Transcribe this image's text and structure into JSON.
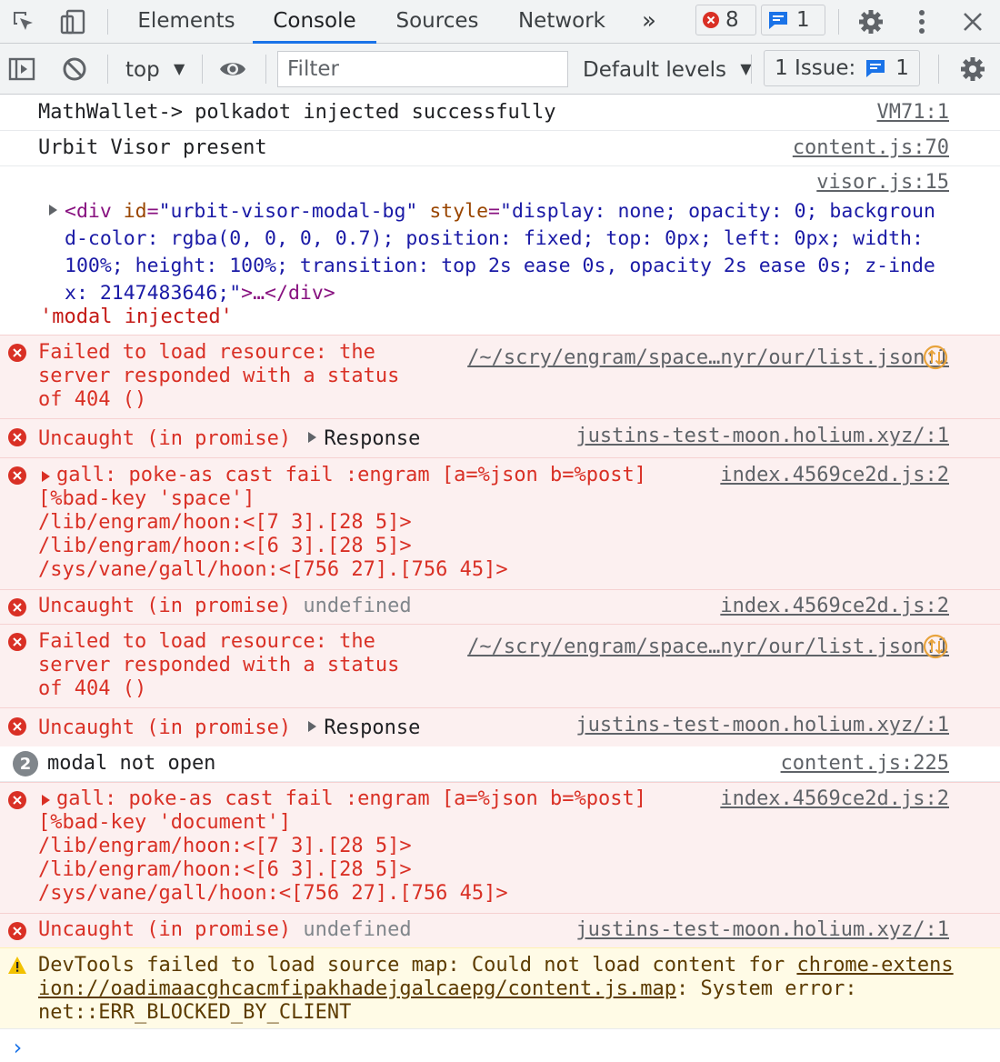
{
  "tabs": {
    "items": [
      "Elements",
      "Console",
      "Sources",
      "Network"
    ],
    "more": "»",
    "error_count": "8",
    "message_count": "1"
  },
  "toolbar": {
    "context": "top",
    "filter_placeholder": "Filter",
    "levels": "Default levels",
    "issues_label": "1 Issue:",
    "issues_count": "1"
  },
  "messages": {
    "m1": {
      "text": "MathWallet-> polkadot injected successfully",
      "source": "VM71:1"
    },
    "m2": {
      "text": "Urbit Visor present",
      "source": "content.js:70"
    },
    "m3": {
      "source": "visor.js:15",
      "tag_open": "<div",
      "attr1": "id",
      "val1": "\"urbit-visor-modal-bg\"",
      "attr2": "style",
      "val2_l1": "\"display: none; opacity: 0; backgroun",
      "val2_l2": "d-color: rgba(0, 0, 0, 0.7); position: fixed; top: 0px; left: 0px; width:",
      "val2_l3": "100%; height: 100%; transition: top 2s ease 0s, opacity 2s ease 0s; z-inde",
      "val2_l4": "x: 2147483646;\"",
      "tag_close": ">…</div>",
      "string": "'modal injected'"
    },
    "e1": {
      "text": "Failed to load resource: the\nserver responded with a status\nof 404 ()",
      "source": "/~/scry/engram/space…nyr/our/list.json:1"
    },
    "e2": {
      "text": "Uncaught (in promise)",
      "obj": "Response",
      "source": "justins-test-moon.holium.xyz/:1"
    },
    "e3": {
      "text": "gall: poke-as cast fail :engram [a=%json b=%post]\n[%bad-key 'space']\n/lib/engram/hoon:<[7 3].[28 5]>\n/lib/engram/hoon:<[6 3].[28 5]>\n/sys/vane/gall/hoon:<[756 27].[756 45]>",
      "source": "index.4569ce2d.js:2"
    },
    "e4": {
      "text": "Uncaught (in promise)",
      "obj": "undefined",
      "source": "index.4569ce2d.js:2"
    },
    "e5": {
      "text": "Failed to load resource: the\nserver responded with a status\nof 404 ()",
      "source": "/~/scry/engram/space…nyr/our/list.json:1"
    },
    "e6": {
      "text": "Uncaught (in promise)",
      "obj": "Response",
      "source": "justins-test-moon.holium.xyz/:1"
    },
    "m4": {
      "badge": "2",
      "text": "modal not open",
      "source": "content.js:225"
    },
    "e7": {
      "text": "gall: poke-as cast fail :engram [a=%json b=%post]\n[%bad-key 'document']\n/lib/engram/hoon:<[7 3].[28 5]>\n/lib/engram/hoon:<[6 3].[28 5]>\n/sys/vane/gall/hoon:<[756 27].[756 45]>",
      "source": "index.4569ce2d.js:2"
    },
    "e8": {
      "text": "Uncaught (in promise)",
      "obj": "undefined",
      "source": "justins-test-moon.holium.xyz/:1"
    },
    "w1": {
      "pre": "DevTools failed to load source map: Could not load content for ",
      "link1": "chrome-extens",
      "link2": "ion://oadimaacghcacmfipakhadejgalcaepg/content.js.map",
      "post1": ": System error:",
      "post2": "net::ERR_BLOCKED_BY_CLIENT"
    }
  },
  "prompt": "›",
  "colors": {
    "accent": "#1a73e8",
    "error": "#d93025",
    "error_bg": "#fcf0f0",
    "warn_bg": "#fffbe6"
  }
}
